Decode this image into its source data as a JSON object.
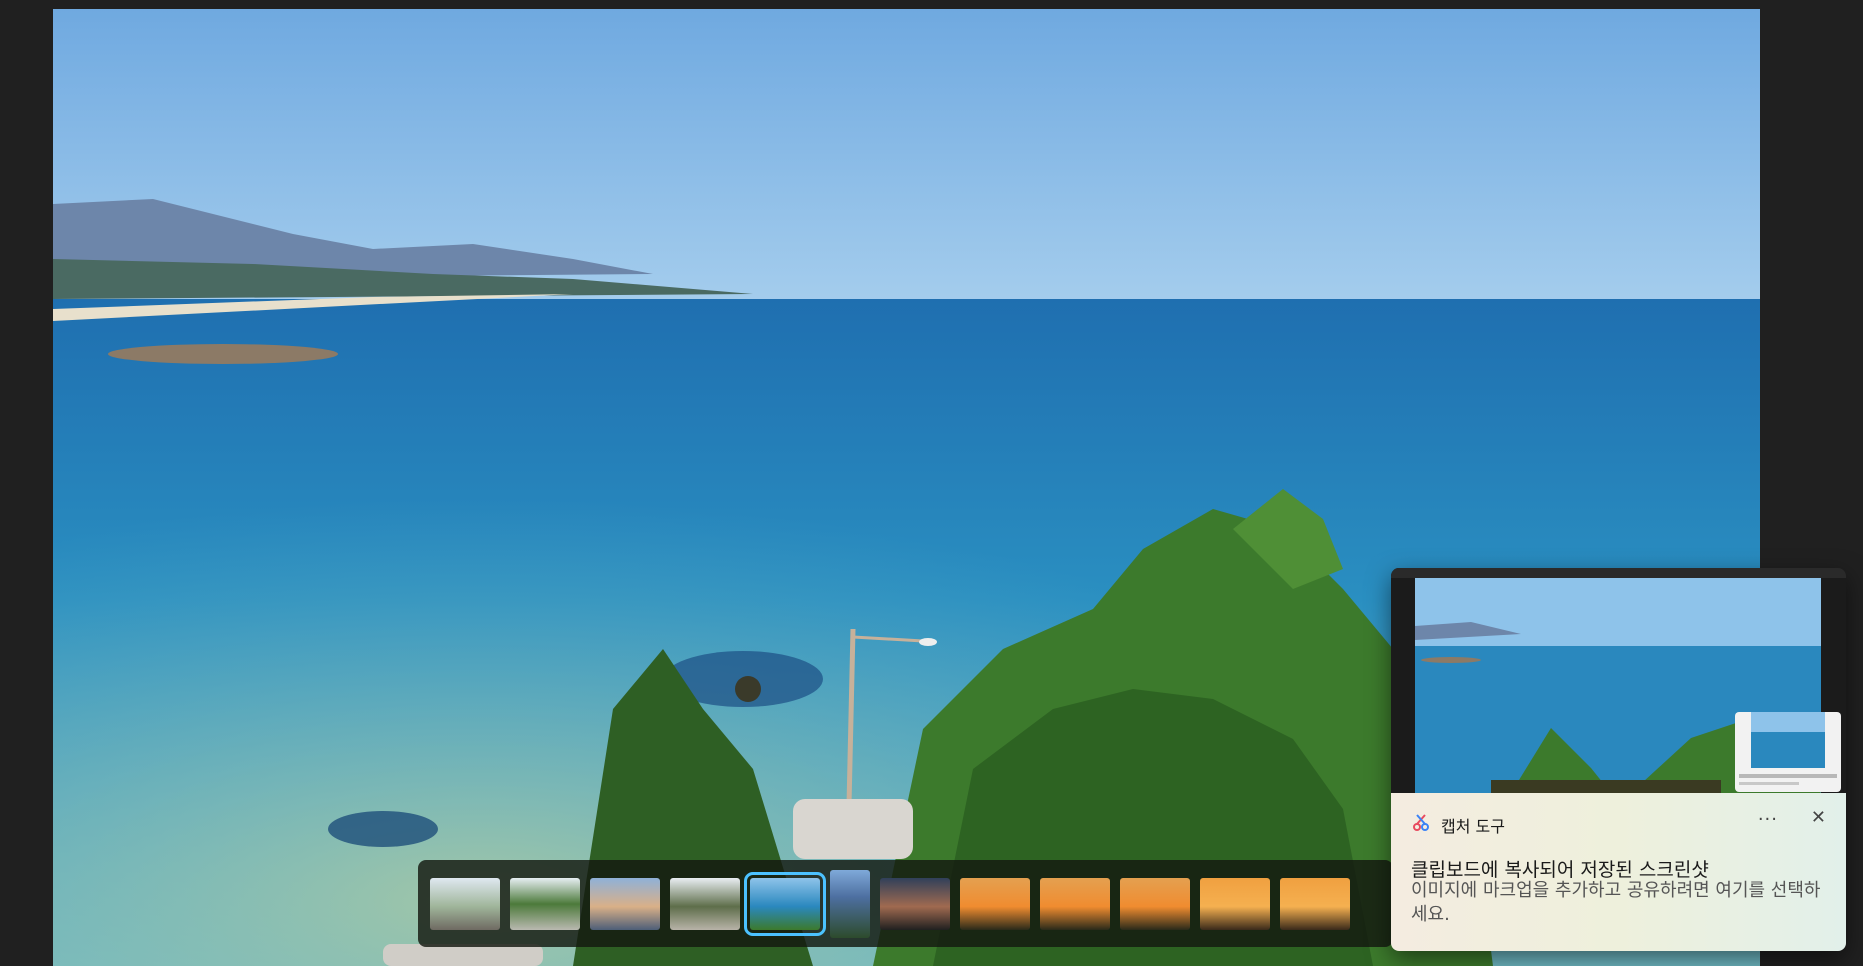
{
  "viewer": {
    "photo_name": "seaside-landscape-photo"
  },
  "filmstrip": {
    "items": [
      {
        "kind": "road-trees"
      },
      {
        "kind": "park-trees"
      },
      {
        "kind": "beach-dusk"
      },
      {
        "kind": "road-sea"
      },
      {
        "kind": "sea-blue",
        "selected": true
      },
      {
        "kind": "portrait-blue"
      },
      {
        "kind": "sunset-dark"
      },
      {
        "kind": "sunset-orange"
      },
      {
        "kind": "sunset-orange"
      },
      {
        "kind": "sunset-orange"
      },
      {
        "kind": "sunset-bright"
      },
      {
        "kind": "sunset-bright"
      }
    ]
  },
  "toast": {
    "app_name": "캡처 도구",
    "title": "클립보드에 복사되어 저장된 스크린샷",
    "message": "이미지에 마크업을 추가하고 공유하려면 여기를 선택하세요.",
    "more_label": "···",
    "close_label": "✕",
    "icon": "snipping-tool-icon"
  },
  "colors": {
    "accent": "#4cc2ff",
    "sky": "#8ec3ea",
    "sea": "#2b8bc0"
  }
}
